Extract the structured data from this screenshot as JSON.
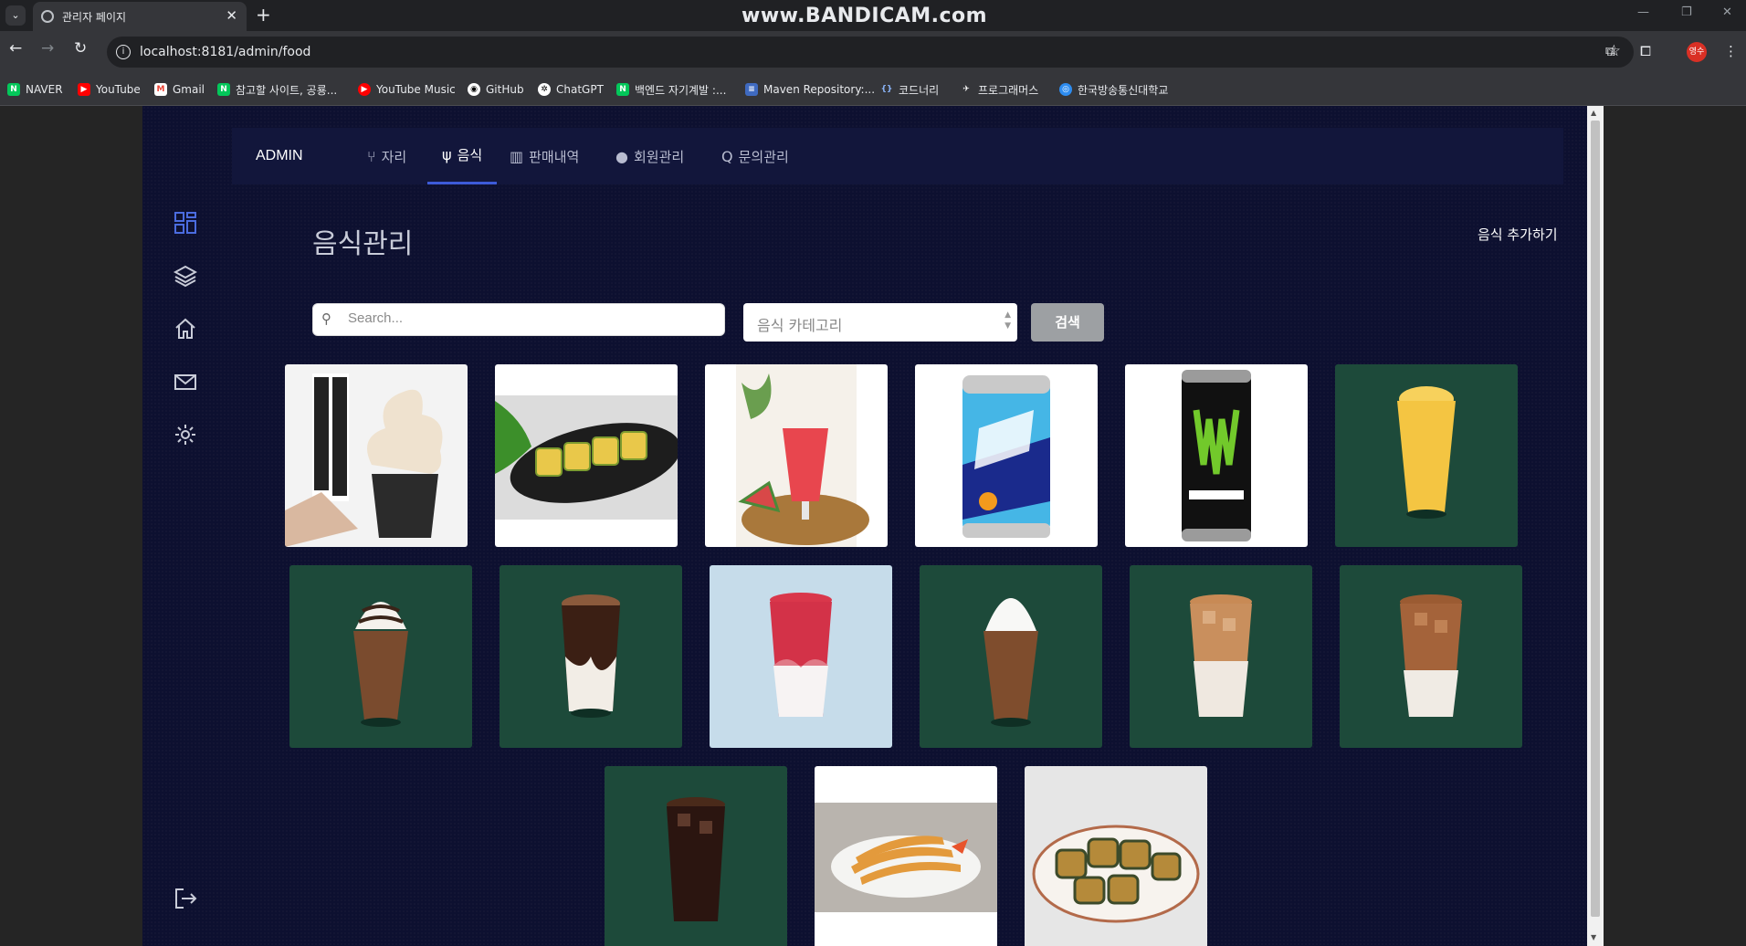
{
  "browser": {
    "tab_title": "관리자 페이지",
    "watermark": "www.BANDICAM.com",
    "url": "localhost:8181/admin/food",
    "profile_initials": "영수",
    "bookmarks": [
      {
        "label": "NAVER",
        "icon": "naver-icon",
        "color": "#03c75a"
      },
      {
        "label": "YouTube",
        "icon": "youtube-icon",
        "color": "#ff0000"
      },
      {
        "label": "Gmail",
        "icon": "gmail-icon",
        "color": "#ea4335"
      },
      {
        "label": "참고할 사이트, 공룡...",
        "icon": "naver-icon",
        "color": "#03c75a"
      },
      {
        "label": "YouTube Music",
        "icon": "youtube-music-icon",
        "color": "#ff0000"
      },
      {
        "label": "GitHub",
        "icon": "github-icon",
        "color": "#ffffff"
      },
      {
        "label": "ChatGPT",
        "icon": "chatgpt-icon",
        "color": "#ffffff"
      },
      {
        "label": "백엔드 자기계발 :...",
        "icon": "naver-icon",
        "color": "#03c75a"
      },
      {
        "label": "Maven Repository:...",
        "icon": "maven-icon",
        "color": "#3f6ac0"
      },
      {
        "label": "코드너리",
        "icon": "code-icon",
        "color": "#8ab4f8"
      },
      {
        "label": "프로그래머스",
        "icon": "programmers-icon",
        "color": "#ffffff"
      },
      {
        "label": "한국방송통신대학교",
        "icon": "knou-icon",
        "color": "#2d8cf0"
      }
    ]
  },
  "nav": {
    "brand": "ADMIN",
    "items": [
      {
        "label": "자리",
        "icon": "seat-icon"
      },
      {
        "label": "음식",
        "icon": "utensils-icon",
        "active": true
      },
      {
        "label": "판매내역",
        "icon": "bar-chart-icon"
      },
      {
        "label": "회원관리",
        "icon": "user-icon"
      },
      {
        "label": "문의관리",
        "icon": "search-q-icon"
      }
    ]
  },
  "sidebar": {
    "icons": [
      "dashboard-icon",
      "layers-icon",
      "home-icon",
      "mail-icon",
      "settings-icon"
    ],
    "logout_icon": "logout-icon"
  },
  "main": {
    "title": "음식관리",
    "add_label": "음식 추가하기",
    "search_placeholder": "Search...",
    "category_placeholder": "음식 카테고리",
    "search_button": "검색"
  },
  "foods": [
    {
      "name": "vanilla-soft-serve",
      "bg": "#f3f3f3"
    },
    {
      "name": "rolled-omelette",
      "bg": "#ffffff"
    },
    {
      "name": "watermelon-juice",
      "bg": "#ffffff"
    },
    {
      "name": "blue-hawaii-can",
      "bg": "#ffffff"
    },
    {
      "name": "monster-energy-can",
      "bg": "#ffffff"
    },
    {
      "name": "mango-smoothie",
      "bg": "#1d4a3a"
    },
    {
      "name": "chocolate-frappuccino",
      "bg": "#1d4a3a"
    },
    {
      "name": "tiramisu-latte",
      "bg": "#1d4a3a"
    },
    {
      "name": "strawberry-latte",
      "bg": "#c6dcea"
    },
    {
      "name": "mocha-frappe",
      "bg": "#1d4a3a"
    },
    {
      "name": "iced-cafe-latte",
      "bg": "#1d4a3a"
    },
    {
      "name": "iced-caramel-latte",
      "bg": "#1d4a3a"
    },
    {
      "name": "iced-americano",
      "bg": "#1d4a3a"
    },
    {
      "name": "fried-shrimp",
      "bg": "#ffffff"
    },
    {
      "name": "seaweed-fritters",
      "bg": "#e6e6e6"
    }
  ]
}
